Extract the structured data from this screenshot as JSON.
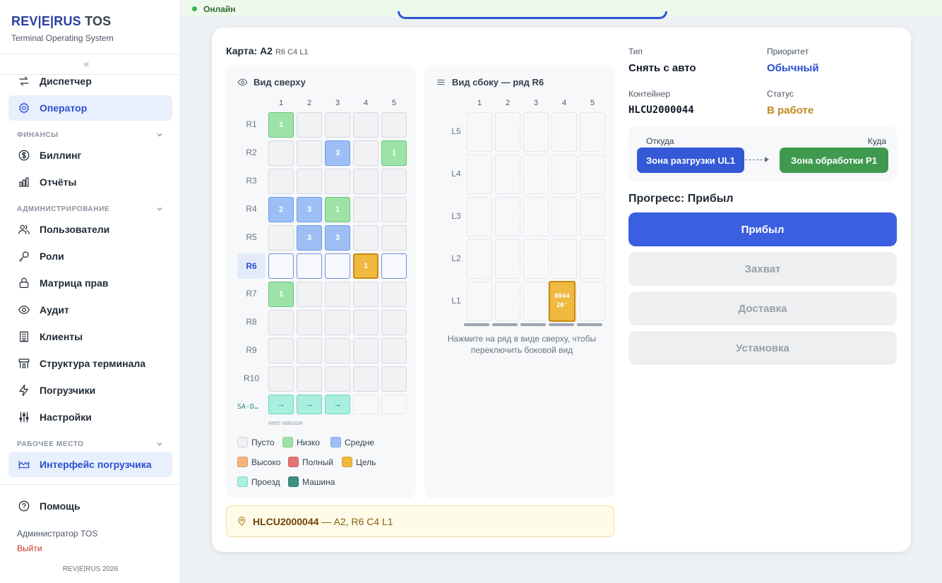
{
  "brand": {
    "name": "REV|E|RUS",
    "suffix": "TOS",
    "subtitle": "Terminal Operating System"
  },
  "sidebar": {
    "collapse_icon": "«",
    "items_top": [
      {
        "label": "Диспетчер",
        "icon": "arrows-swap-icon"
      },
      {
        "label": "Оператор",
        "icon": "gear-icon",
        "active": true
      }
    ],
    "sections": [
      {
        "title": "ФИНАНСЫ",
        "items": [
          {
            "label": "Биллинг",
            "icon": "dollar-icon"
          },
          {
            "label": "Отчёты",
            "icon": "chart-icon"
          }
        ]
      },
      {
        "title": "АДМИНИСТРИРОВАНИЕ",
        "items": [
          {
            "label": "Пользователи",
            "icon": "users-icon"
          },
          {
            "label": "Роли",
            "icon": "key-icon"
          },
          {
            "label": "Матрица прав",
            "icon": "lock-icon"
          },
          {
            "label": "Аудит",
            "icon": "eye-icon"
          },
          {
            "label": "Клиенты",
            "icon": "building-icon"
          },
          {
            "label": "Структура терминала",
            "icon": "structure-icon"
          },
          {
            "label": "Погрузчики",
            "icon": "bolt-icon"
          },
          {
            "label": "Настройки",
            "icon": "sliders-icon"
          }
        ]
      },
      {
        "title": "РАБОЧЕЕ МЕСТО",
        "items": [
          {
            "label": "Интерфейс погрузчика",
            "icon": "forklift-icon",
            "active": true
          }
        ]
      }
    ],
    "help": "Помощь",
    "user": "Администратор TOS",
    "logout": "Выйти",
    "copyright": "REV|E|RUS 2026"
  },
  "status": {
    "label": "Онлайн",
    "color": "#3bb54a"
  },
  "map": {
    "title": "Карта: A2",
    "subtitle": "R6 C4 L1",
    "top_view": {
      "title": "Вид сверху",
      "columns": [
        "1",
        "2",
        "3",
        "4",
        "5"
      ],
      "rows": [
        {
          "label": "R1",
          "cells": [
            {
              "v": "1",
              "t": "low"
            },
            {},
            {},
            {},
            {}
          ]
        },
        {
          "label": "R2",
          "cells": [
            {},
            {},
            {
              "v": "3",
              "t": "mid"
            },
            {},
            {
              "v": "1",
              "t": "low"
            }
          ]
        },
        {
          "label": "R3",
          "cells": [
            {},
            {},
            {},
            {},
            {}
          ]
        },
        {
          "label": "R4",
          "cells": [
            {
              "v": "2",
              "t": "mid"
            },
            {
              "v": "3",
              "t": "mid"
            },
            {
              "v": "1",
              "t": "low"
            },
            {},
            {}
          ]
        },
        {
          "label": "R5",
          "cells": [
            {},
            {
              "v": "3",
              "t": "mid"
            },
            {
              "v": "3",
              "t": "mid"
            },
            {},
            {}
          ]
        },
        {
          "label": "R6",
          "selected": true,
          "cells": [
            {
              "t": "rowsel"
            },
            {
              "t": "rowsel"
            },
            {
              "t": "rowsel"
            },
            {
              "v": "1",
              "t": "target"
            },
            {
              "t": "rowsel"
            }
          ]
        },
        {
          "label": "R7",
          "cells": [
            {
              "v": "1",
              "t": "low"
            },
            {},
            {},
            {},
            {}
          ]
        },
        {
          "label": "R8",
          "cells": [
            {},
            {},
            {},
            {},
            {}
          ]
        },
        {
          "label": "R9",
          "cells": [
            {},
            {},
            {},
            {},
            {}
          ]
        },
        {
          "label": "R10",
          "cells": [
            {},
            {},
            {},
            {},
            {}
          ]
        }
      ],
      "lane": {
        "label": "SA-D…",
        "cells": [
          "→",
          "→",
          "→",
          "",
          ""
        ],
        "note": "нет машин"
      }
    },
    "legend": [
      {
        "label": "Пусто",
        "color": "#f1f2f4"
      },
      {
        "label": "Низко",
        "color": "#9de3a8"
      },
      {
        "label": "Средне",
        "color": "#9ebff5"
      },
      {
        "label": "Высоко",
        "color": "#f5b57a"
      },
      {
        "label": "Полный",
        "color": "#e57373"
      },
      {
        "label": "Цель",
        "color": "#f0b93f"
      },
      {
        "label": "Проезд",
        "color": "#a8efe0"
      },
      {
        "label": "Машина",
        "color": "#3d8f80"
      }
    ],
    "side_view": {
      "title": "Вид сбоку — ряд R6",
      "columns": [
        "1",
        "2",
        "3",
        "4",
        "5"
      ],
      "tiers": [
        "L5",
        "L4",
        "L3",
        "L2",
        "L1"
      ],
      "container": {
        "line1": "0044",
        "line2": "20'"
      },
      "hint": "Нажмите на ряд в виде сверху, чтобы переключить боковой вид"
    },
    "location": {
      "container": "HLCU2000044",
      "text": "— A2, R6 C4 L1"
    }
  },
  "task": {
    "type_label": "Тип",
    "type_value": "Снять с авто",
    "priority_label": "Приоритет",
    "priority_value": "Обычный",
    "container_label": "Контейнер",
    "container_value": "HLCU2000044",
    "status_label": "Статус",
    "status_value": "В работе",
    "from_label": "Откуда",
    "from_value": "Зона разгрузки UL1",
    "to_label": "Куда",
    "to_value": "Зона обработки P1",
    "progress_title": "Прогресс: Прибыл",
    "steps": [
      "Прибыл",
      "Захват",
      "Доставка",
      "Установка"
    ],
    "colors": {
      "priority": "#2b4fd0",
      "status": "#c08a1e",
      "from": "#3359d6",
      "to": "#3f9a4f",
      "accent": "#3b5fe0"
    }
  }
}
